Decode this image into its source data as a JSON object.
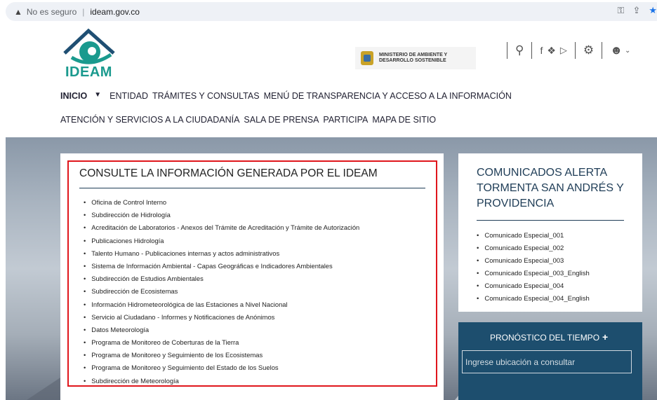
{
  "browser": {
    "security_label": "No es seguro",
    "host": "ideam.gov.co"
  },
  "header": {
    "logo_text": "IDEAM",
    "ministry_text": "MINISTERIO DE AMBIENTE Y DESARROLLO SOSTENIBLE"
  },
  "nav": {
    "inicio": "INICIO",
    "row1": [
      "ENTIDAD",
      "TRÁMITES Y CONSULTAS",
      "MENÚ DE TRANSPARENCIA Y ACCESO A LA INFORMACIÓN"
    ],
    "row2": [
      "ATENCIÓN Y SERVICIOS A LA CIUDADANÍA",
      "SALA DE PRENSA",
      "PARTICIPA",
      "MAPA DE SITIO"
    ]
  },
  "consulte": {
    "title": "CONSULTE LA INFORMACIÓN GENERADA POR EL IDEAM",
    "items": [
      "Oficina de Control Interno",
      "Subdirección de Hidrología",
      "Acreditación de Laboratorios - Anexos del Trámite de Acreditación y Trámite de Autorización",
      "Publicaciones Hidrología",
      "Talento Humano - Publicaciones internas y actos administrativos",
      "Sistema de Información Ambiental - Capas Geográficas e Indicadores Ambientales",
      "Subdirección de Estudios Ambientales",
      "Subdirección de Ecosistemas",
      "Información Hidrometeorológica de las Estaciones a Nivel Nacional",
      "Servicio al Ciudadano - Informes y Notificaciones de Anónimos",
      "Datos Meteorología",
      "Programa de Monitoreo de Coberturas de la Tierra",
      "Programa de Monitoreo y Seguimiento de los Ecosistemas",
      "Programa de Monitoreo y Seguimiento del Estado de los Suelos",
      "Subdirección de Meteorología"
    ]
  },
  "comunicados": {
    "title": "COMUNICADOS ALERTA TORMENTA SAN ANDRÉS Y PROVIDENCIA",
    "items": [
      "Comunicado Especial_001",
      "Comunicado Especial_002",
      "Comunicado Especial_003",
      "Comunicado Especial_003_English",
      "Comunicado Especial_004",
      "Comunicado Especial_004_English"
    ]
  },
  "forecast": {
    "title": "PRONÓSTICO DEL TIEMPO",
    "plus": "+",
    "placeholder": "Ingrese ubicación a consultar"
  },
  "colors": {
    "accent": "#1f3d57",
    "highlight": "#e0161c",
    "forecast_bg": "#1d4e6e",
    "logo_teal": "#1a9a8e"
  }
}
